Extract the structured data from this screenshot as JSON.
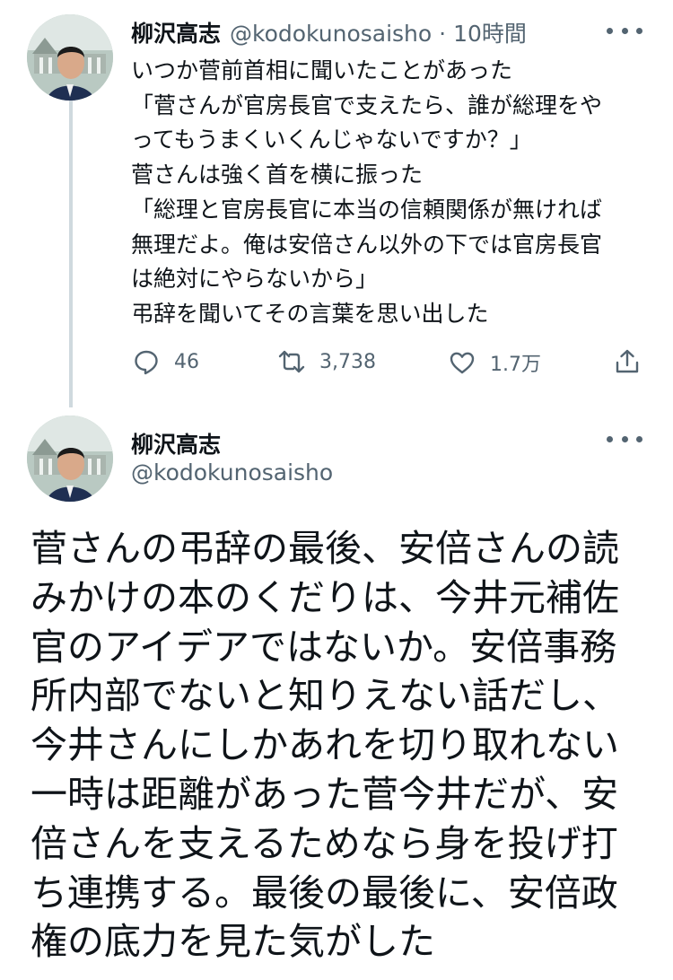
{
  "reply_tweet": {
    "author_name": "柳沢高志",
    "author_handle": "@kodokunosaisho",
    "separator": "·",
    "time": "10時間",
    "text_lines": [
      "いつか菅前首相に聞いたことがあった",
      "「菅さんが官房長官で支えたら、誰が総理をや",
      "ってもうまくいくんじゃないですか？」",
      "菅さんは強く首を横に振った",
      "「総理と官房長官に本当の信頼関係が無ければ",
      "無理だよ。俺は安倍さん以外の下では官房長官",
      "は絶対にやらないから」",
      "弔辞を聞いてその言葉を思い出した"
    ],
    "replies": "46",
    "retweets": "3,738",
    "likes": "1.7万"
  },
  "main_tweet": {
    "author_name": "柳沢高志",
    "author_handle": "@kodokunosaisho",
    "text_lines": [
      "菅さんの弔辞の最後、安倍さんの読",
      "みかけの本のくだりは、今井元補佐",
      "官のアイデアではないか。安倍事務",
      "所内部でないと知りえない話だし、",
      "今井さんにしかあれを切り取れない",
      "一時は距離があった菅今井だが、安",
      "倍さんを支えるためなら身を投げ打",
      "ち連携する。最後の最後に、安倍政",
      "権の底力を見た気がした"
    ]
  },
  "icons": [
    "avatar",
    "more-icon",
    "reply-icon",
    "retweet-icon",
    "like-icon",
    "share-icon"
  ],
  "colors": {
    "text": "#0f1419",
    "secondary": "#536471",
    "thread_line": "#cfd9de"
  }
}
